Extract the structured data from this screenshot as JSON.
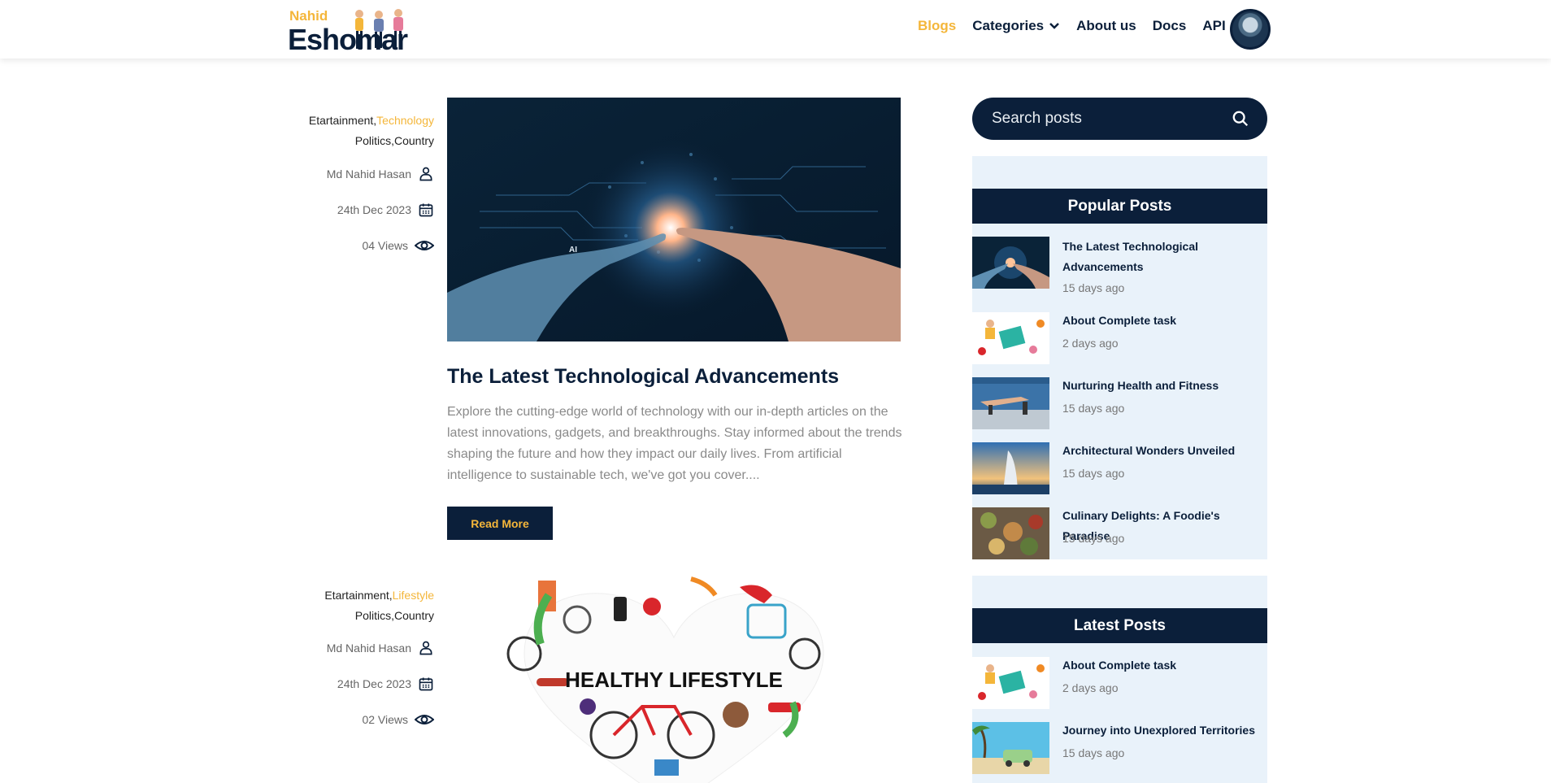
{
  "header": {
    "logo_top": "Nahid",
    "logo_bottom": "Eshomar",
    "nav": [
      {
        "label": "Blogs"
      },
      {
        "label": "Categories"
      },
      {
        "label": "About us"
      },
      {
        "label": "Docs"
      },
      {
        "label": "API"
      }
    ]
  },
  "posts": [
    {
      "cat_a": "Etartainment,",
      "cat_b": "Technology",
      "cats_line2": "Politics,Country",
      "author": "Md Nahid Hasan",
      "date": "24th Dec 2023",
      "views": "04 Views",
      "title": "The Latest Technological Advancements",
      "excerpt": "Explore the cutting-edge world of technology with our in-depth articles on the latest innovations, gadgets, and breakthroughs. Stay informed about the trends shaping the future and how they impact our daily lives. From artificial intelligence to sustainable tech, we've got you cover....",
      "read_more": "Read More",
      "image_caption": "AI"
    },
    {
      "cat_a": "Etartainment,",
      "cat_b": "Lifestyle",
      "cats_line2": "Politics,Country",
      "author": "Md Nahid Hasan",
      "date": "24th Dec 2023",
      "views": "02 Views",
      "image_caption": "HEALTHY LIFESTYLE"
    }
  ],
  "sidebar": {
    "search_placeholder": "Search posts",
    "popular_title": "Popular Posts",
    "popular": [
      {
        "title": "The Latest Technological Advancements",
        "date": "15 days ago"
      },
      {
        "title": "About Complete task",
        "date": "2 days ago"
      },
      {
        "title": "Nurturing Health and Fitness",
        "date": "15 days ago"
      },
      {
        "title": "Architectural Wonders Unveiled",
        "date": "15 days ago"
      },
      {
        "title": "Culinary Delights: A Foodie's Paradise",
        "date": "15 days ago"
      }
    ],
    "latest_title": "Latest Posts",
    "latest": [
      {
        "title": "About Complete task",
        "date": "2 days ago"
      },
      {
        "title": "Journey into Unexplored Territories",
        "date": "15 days ago"
      }
    ]
  },
  "colors": {
    "navy": "#0b1f3a",
    "accent": "#f4b63a",
    "sidebar_bg": "#e9f2fa"
  }
}
